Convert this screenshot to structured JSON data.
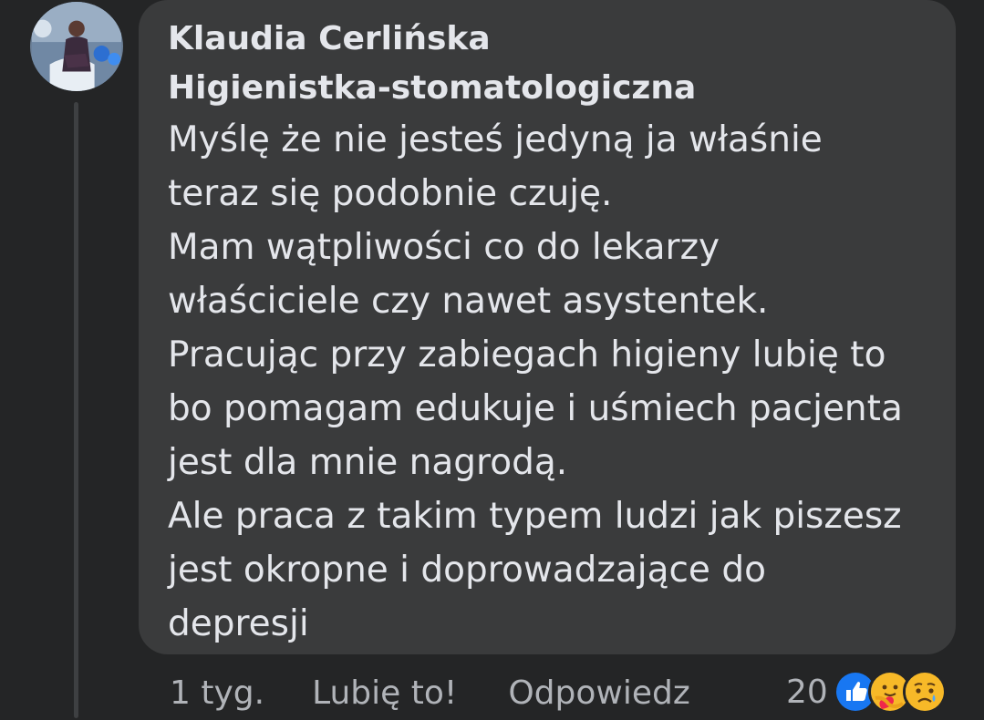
{
  "comment": {
    "author": "Klaudia Cerlińska",
    "lines": [
      "Higienistka-stomatologiczna",
      "Myślę że nie jesteś jedyną ja właśnie",
      "teraz się podobnie czuję.",
      "Mam wątpliwości co do lekarzy",
      "właściciele czy nawet asystentek.",
      "Pracując przy zabiegach higieny lubię to",
      "bo pomagam edukuje i uśmiech pacjenta",
      "jest dla mnie nagrodą.",
      "Ale praca z takim typem ludzi jak piszesz",
      "jest okropne i doprowadzające do",
      "depresji"
    ]
  },
  "actions": {
    "time": "1 tyg.",
    "like": "Lubię to!",
    "reply": "Odpowiedz"
  },
  "reactions": {
    "count": "20",
    "icons": [
      "like-reaction-icon",
      "care-reaction-icon",
      "sad-reaction-icon"
    ]
  },
  "colors": {
    "background": "#242526",
    "bubble": "#3a3b3c",
    "text": "#e4e6eb",
    "secondary": "#b0b3b8",
    "like_blue": "#1877f2",
    "reaction_yellow": "#f7b928"
  }
}
